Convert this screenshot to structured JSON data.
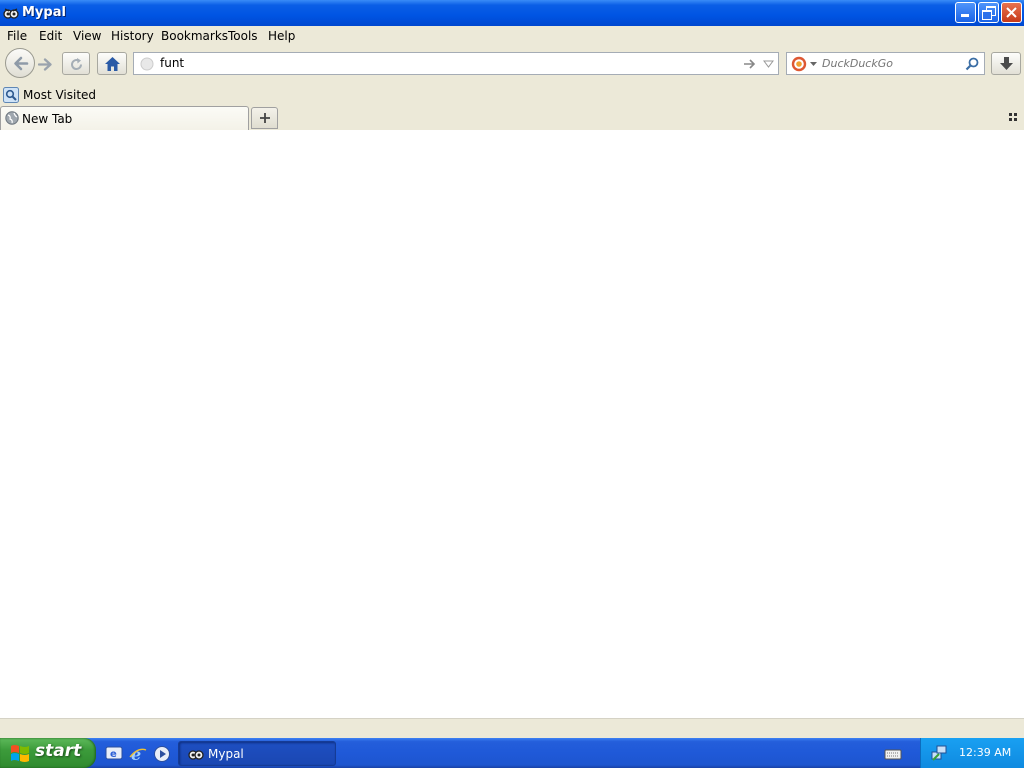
{
  "window": {
    "title": "Mypal"
  },
  "menu": [
    "File",
    "Edit",
    "View",
    "History",
    "Bookmarks",
    "Tools",
    "Help"
  ],
  "urlbar": {
    "value": "funt"
  },
  "search": {
    "engine": "DuckDuckGo",
    "placeholder": "DuckDuckGo"
  },
  "bookmarks": {
    "most_visited": "Most Visited"
  },
  "tabs": [
    {
      "label": "New Tab"
    }
  ],
  "taskbar": {
    "start": "start",
    "window_button": "Mypal",
    "clock": "12:39 AM"
  },
  "colors": {
    "titlebar": "#0054e3",
    "taskbar": "#245edb",
    "start": "#3c9b3b",
    "tray": "#0f8ae0"
  }
}
